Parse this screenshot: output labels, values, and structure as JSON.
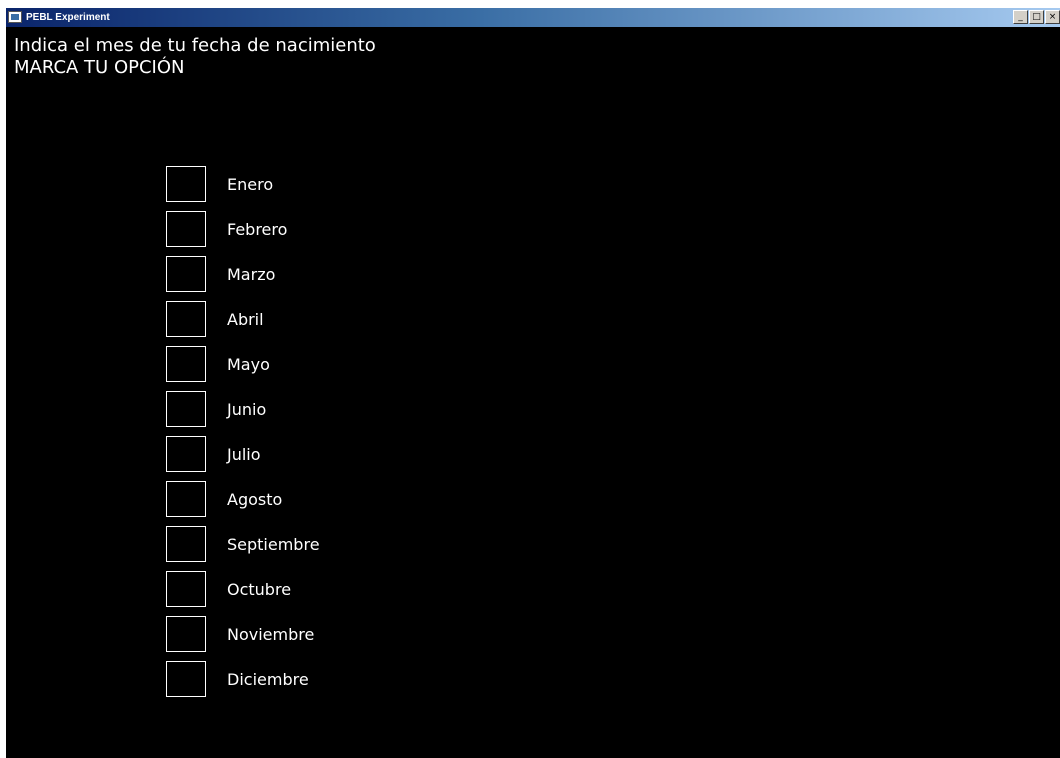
{
  "window": {
    "title": "PEBL Experiment",
    "controls": {
      "minimize": "_",
      "maximize": "□",
      "close": "×"
    }
  },
  "prompt": {
    "line1": "Indica el mes de tu fecha de nacimiento",
    "line2": "MARCA TU OPCIÓN"
  },
  "options": [
    {
      "label": "Enero",
      "checked": false
    },
    {
      "label": "Febrero",
      "checked": false
    },
    {
      "label": "Marzo",
      "checked": false
    },
    {
      "label": "Abril",
      "checked": false
    },
    {
      "label": "Mayo",
      "checked": false
    },
    {
      "label": "Junio",
      "checked": false
    },
    {
      "label": "Julio",
      "checked": false
    },
    {
      "label": "Agosto",
      "checked": false
    },
    {
      "label": "Septiembre",
      "checked": false
    },
    {
      "label": "Octubre",
      "checked": false
    },
    {
      "label": "Noviembre",
      "checked": false
    },
    {
      "label": "Diciembre",
      "checked": false
    }
  ],
  "colors": {
    "background": "#000000",
    "text": "#ffffff",
    "checkbox_border": "#ffffff",
    "titlebar_start": "#0a246a",
    "titlebar_end": "#a6caf0"
  }
}
